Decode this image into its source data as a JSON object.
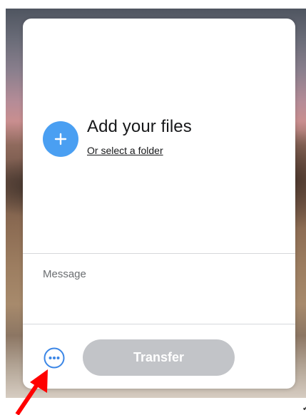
{
  "upload": {
    "title": "Add your files",
    "folder_link": "Or select a folder",
    "add_icon": "plus-icon",
    "accent": "#4a9ff2"
  },
  "message": {
    "placeholder": "Message",
    "value": ""
  },
  "footer": {
    "more_icon": "more-options-icon",
    "transfer_label": "Transfer",
    "transfer_color": "#c2c4c8"
  },
  "annotation": {
    "arrow_color": "#ff0000"
  }
}
